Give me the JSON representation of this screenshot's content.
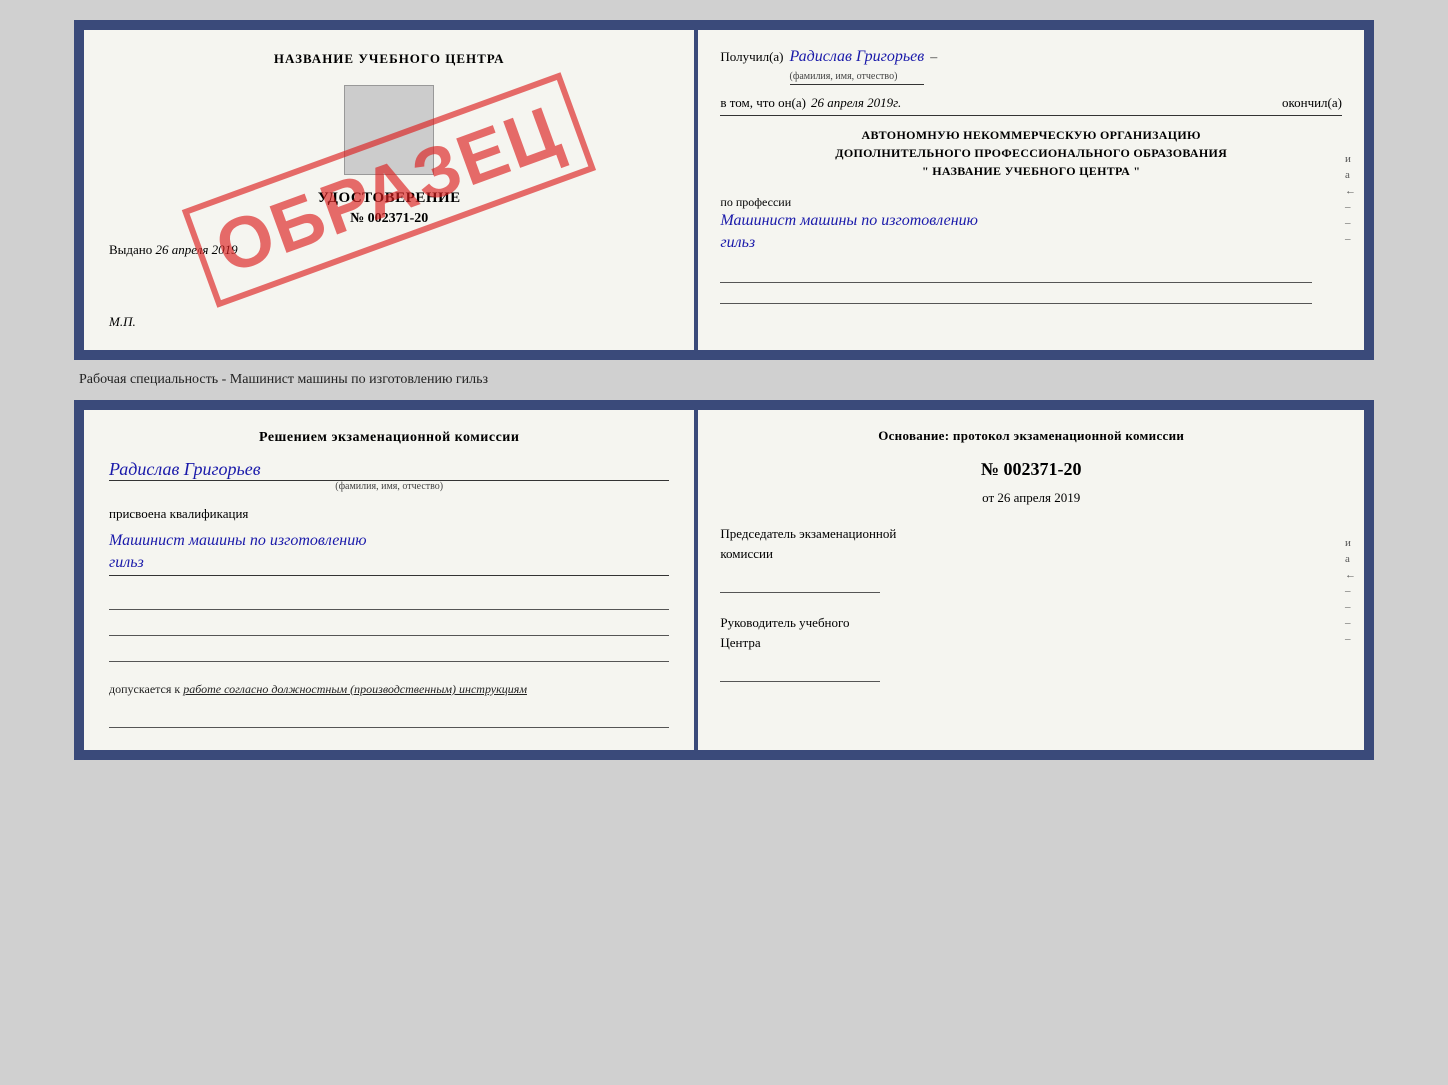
{
  "page": {
    "background": "#d0d0d0"
  },
  "top_cert": {
    "left": {
      "title": "НАЗВАНИЕ УЧЕБНОГО ЦЕНТРА",
      "udostoverenie_label": "УДОСТОВЕРЕНИЕ",
      "nomer": "№ 002371-20",
      "vydano_label": "Выдано",
      "vydano_date": "26 апреля 2019",
      "mp_label": "М.П.",
      "obrazets": "ОБРАЗЕЦ"
    },
    "right": {
      "poluchil_label": "Получил(а)",
      "name": "Радислав Григорьев",
      "fio_hint": "(фамилия, имя, отчество)",
      "dash": "–",
      "vtom_label": "в том, что он(а)",
      "date": "26 апреля 2019г.",
      "okonchil_label": "окончил(а)",
      "avt_line1": "АВТОНОМНУЮ НЕКОММЕРЧЕСКУЮ ОРГАНИЗАЦИЮ",
      "avt_line2": "ДОПОЛНИТЕЛЬНОГО ПРОФЕССИОНАЛЬНОГО ОБРАЗОВАНИЯ",
      "center_name_quotes": "\"  НАЗВАНИЕ УЧЕБНОГО ЦЕНТРА  \"",
      "po_professii": "по профессии",
      "qualification": "Машинист машины по изготовлению",
      "qualification2": "гильз",
      "side_letters": [
        "и",
        "а",
        "←",
        "–",
        "–",
        "–"
      ]
    }
  },
  "caption": "Рабочая специальность - Машинист машины по изготовлению гильз",
  "bottom_cert": {
    "left": {
      "resheniyem": "Решением экзаменационной комиссии",
      "name": "Радислав Григорьев",
      "fio_hint": "(фамилия, имя, отчество)",
      "prisvoena": "присвоена квалификация",
      "kval1": "Машинист машины по изготовлению",
      "kval2": "гильз",
      "dopuskaetsya": "допускается к",
      "dopusk_text": "работе согласно должностным (производственным) инструкциям"
    },
    "right": {
      "osnovanie": "Основание: протокол экзаменационной комиссии",
      "nomer": "№ 002371-20",
      "ot_label": "от",
      "ot_date": "26 апреля 2019",
      "predsedatel_line1": "Председатель экзаменационной",
      "predsedatel_line2": "комиссии",
      "rukovoditel_line1": "Руководитель учебного",
      "rukovoditel_line2": "Центра",
      "side_letters": [
        "и",
        "а",
        "←",
        "–",
        "–",
        "–",
        "–"
      ]
    }
  }
}
